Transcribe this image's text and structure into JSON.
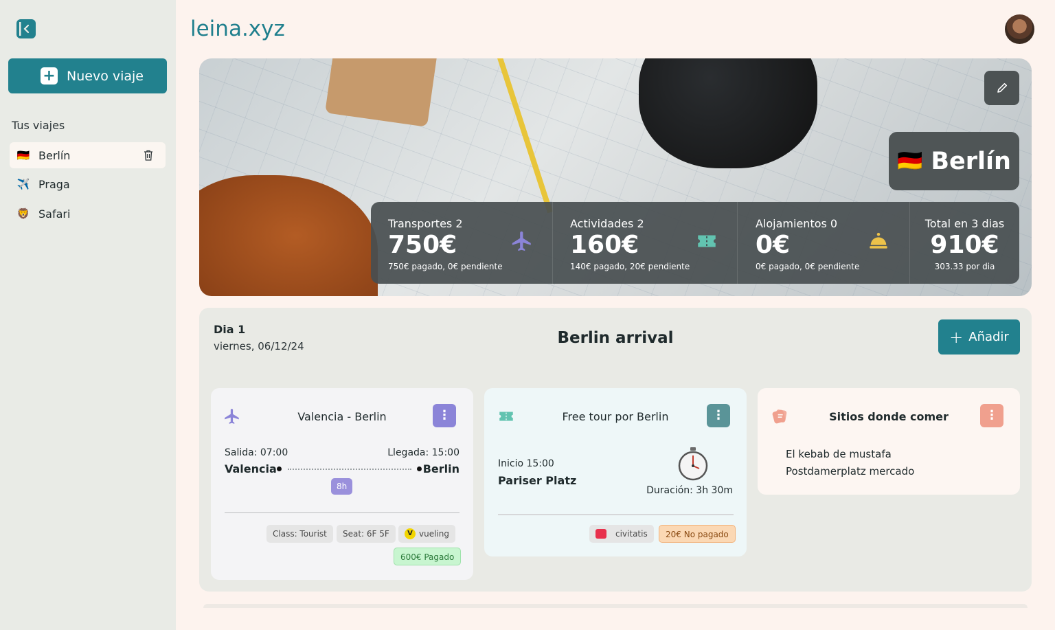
{
  "app": {
    "brand": "leina.xyz"
  },
  "sidebar": {
    "new_trip_label": "Nuevo viaje",
    "trips_heading": "Tus viajes",
    "items": [
      {
        "emoji": "🇩🇪",
        "label": "Berlín",
        "active": true
      },
      {
        "emoji": "✈️",
        "label": "Praga",
        "active": false
      },
      {
        "emoji": "🦁",
        "label": "Safari",
        "active": false
      }
    ]
  },
  "hero": {
    "city_flag": "🇩🇪",
    "city_name": "Berlín",
    "stats": [
      {
        "label": "Transportes 2",
        "value": "750€",
        "sub": "750€ pagado, 0€ pendiente",
        "icon": "plane-icon",
        "color": "#8b84d8"
      },
      {
        "label": "Actividades 2",
        "value": "160€",
        "sub": "140€ pagado, 20€ pendiente",
        "icon": "ticket-icon",
        "color": "#62c3b0"
      },
      {
        "label": "Alojamientos 0",
        "value": "0€",
        "sub": "0€ pagado, 0€ pendiente",
        "icon": "bell-icon",
        "color": "#ecc24a"
      },
      {
        "label": "Total en 3 dias",
        "value": "910€",
        "sub": "303.33 por dia"
      }
    ]
  },
  "day": {
    "number": "Dia 1",
    "date": "viernes, 06/12/24",
    "title": "Berlin arrival",
    "add_label": "Añadir",
    "cards": {
      "flight": {
        "title": "Valencia - Berlin",
        "departure_label": "Salida: 07:00",
        "arrival_label": "Llegada: 15:00",
        "from": "Valencia",
        "to": "Berlin",
        "duration": "8h",
        "class": "Class: Tourist",
        "seat": "Seat: 6F 5F",
        "airline": "vueling",
        "payment": "600€ Pagado"
      },
      "tour": {
        "title": "Free tour por Berlin",
        "start": "Inicio 15:00",
        "place": "Pariser Platz",
        "duration": "Duración: 3h 30m",
        "provider": "civitatis",
        "payment": "20€ No pagado"
      },
      "food": {
        "title": "Sitios donde comer",
        "items": [
          "El kebab de mustafa",
          "Postdamerplatz mercado"
        ]
      }
    }
  },
  "colors": {
    "accent": "#22818e",
    "flight": "#8b84d8",
    "tour": "#5a9498",
    "food": "#f0a08e"
  }
}
